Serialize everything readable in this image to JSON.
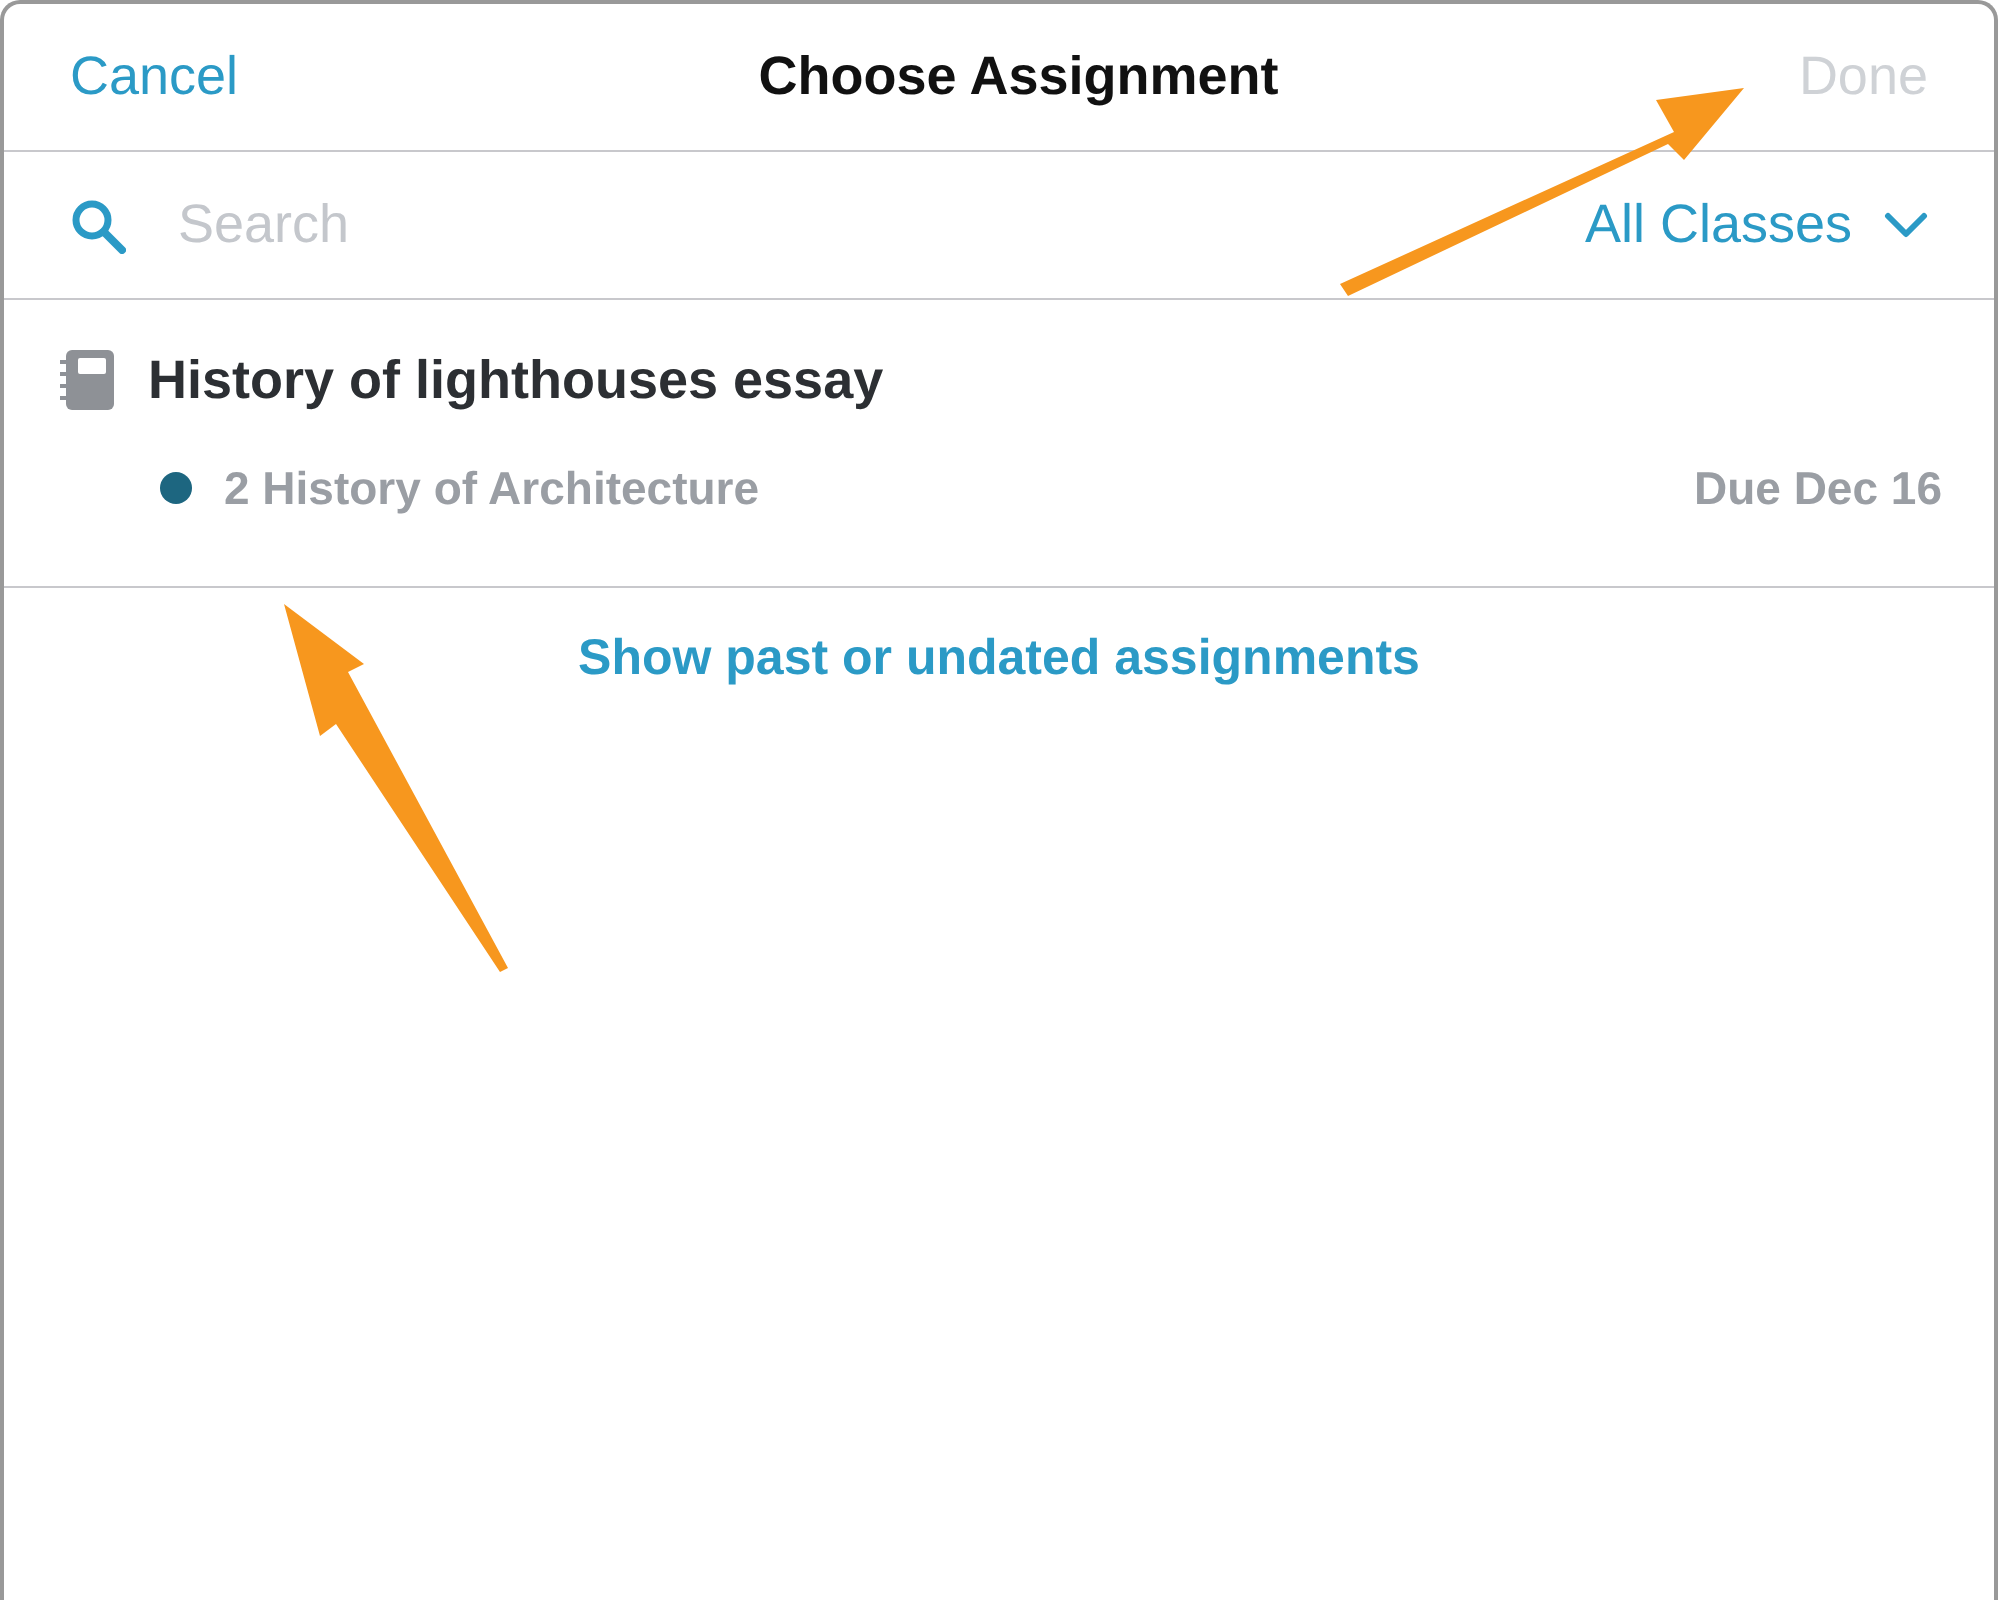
{
  "nav_bar": {
    "cancel": "Cancel",
    "title": "Choose Assignment",
    "done": {
      "label": "Done",
      "disabled": true
    }
  },
  "search": {
    "placeholder": "Search",
    "filter": "All Classes"
  },
  "assignments": [
    {
      "title": "History of lighthouses essay",
      "class": "2 History of Architecture",
      "color": "#1d6680",
      "due": "Due Dec 16"
    }
  ],
  "show_past_link": "Show past or undated assignments"
}
